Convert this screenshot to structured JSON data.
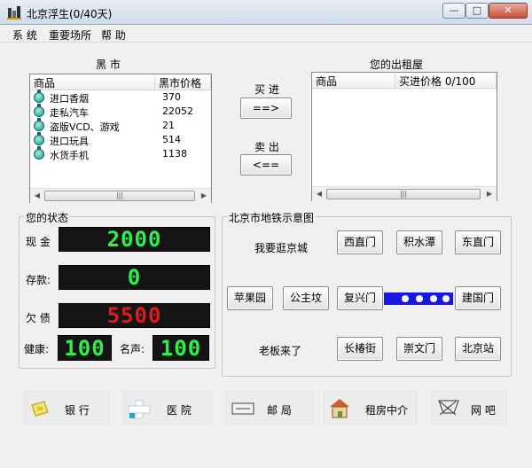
{
  "window": {
    "title": "北京浮生(0/40天)"
  },
  "menu": [
    "系 统",
    "重要场所",
    "帮 助"
  ],
  "black_market": {
    "title": "黑 市",
    "columns": [
      "商品",
      "黑市价格"
    ],
    "items": [
      {
        "name": "进口香烟",
        "price": "370"
      },
      {
        "name": "走私汽车",
        "price": "22052"
      },
      {
        "name": "盗版VCD、游戏",
        "price": "21"
      },
      {
        "name": "进口玩具",
        "price": "514"
      },
      {
        "name": "水货手机",
        "price": "1138"
      }
    ]
  },
  "trade": {
    "buy_label": "买 进",
    "buy_button": "==>",
    "sell_label": "卖 出",
    "sell_button": "<=="
  },
  "rental": {
    "title": "您的出租屋",
    "columns": [
      "商品",
      "买进价格 0/100"
    ]
  },
  "status": {
    "title": "您的状态",
    "cash_label": "现 金",
    "cash": "2000",
    "deposit_label": "存款:",
    "deposit": "0",
    "debt_label": "欠 债",
    "debt": "5500",
    "health_label": "健康:",
    "health": "100",
    "fame_label": "名声:",
    "fame": "100"
  },
  "subway": {
    "title": "北京市地铁示意图",
    "row1_text": "我要逛京城",
    "row3_text": "老板来了",
    "stations": {
      "xizhimen": "西直门",
      "jishuitan": "积水潭",
      "dongzhimen": "东直门",
      "pingguoyuan": "苹果园",
      "gongzhufen": "公主坟",
      "fuxingmen": "复兴门",
      "jianguomen": "建国门",
      "changchunjie": "长椿街",
      "chongwenmen": "崇文门",
      "beijingzhan": "北京站"
    }
  },
  "bottom": {
    "bank": "银 行",
    "hospital": "医 院",
    "post": "邮 局",
    "agency": "租房中介",
    "netcafe": "网 吧"
  },
  "colors": {
    "led_green": "#2df04a",
    "led_red": "#e01919",
    "line_blue": "#1818e6"
  }
}
